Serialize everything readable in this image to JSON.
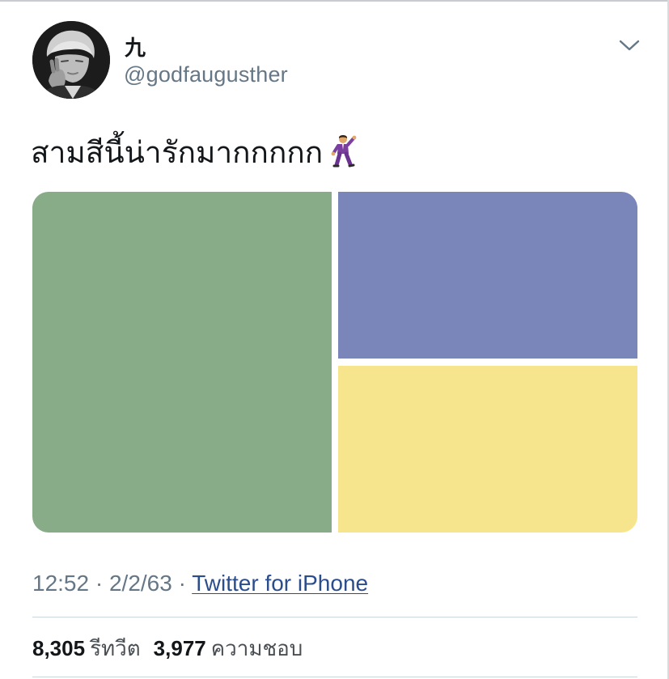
{
  "tweet": {
    "display_name": "九",
    "handle": "@godfaugusther",
    "text": "สามสีนี้น่ารักมากกกกก",
    "emoji": "man-dancing",
    "media": {
      "tile_colors": [
        "#88ab88",
        "#7a86b9",
        "#f7e58e"
      ]
    },
    "meta": {
      "time": "12:52",
      "separator": "·",
      "date": "2/2/63",
      "source": "Twitter for iPhone"
    },
    "stats": {
      "retweets_count": "8,305",
      "retweets_label": "รีทวีต",
      "likes_count": "3,977",
      "likes_label": "ความชอบ"
    },
    "icons": {
      "menu": "chevron-down-icon",
      "avatar": "avatar"
    }
  }
}
